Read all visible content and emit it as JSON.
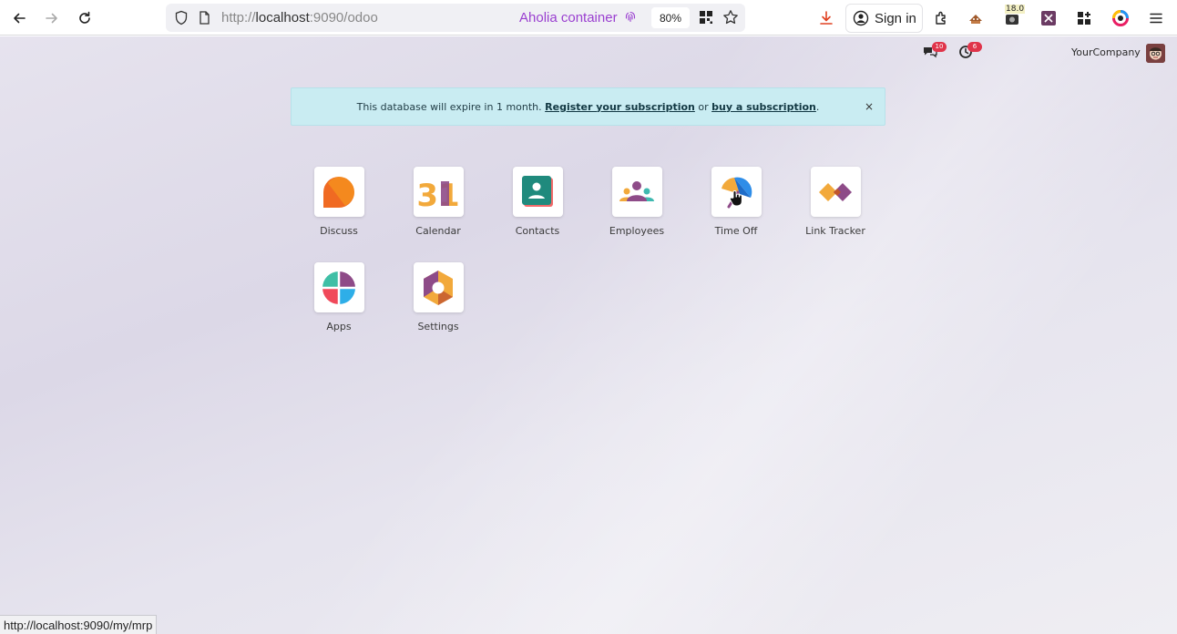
{
  "browser": {
    "url_scheme": "http://",
    "url_host": "localhost",
    "url_path": ":9090/odoo",
    "container": "Aholia container",
    "zoom": "80%",
    "signin_label": "Sign in",
    "ext_badge": "18.0"
  },
  "systray": {
    "messages_count": "10",
    "activities_count": "6",
    "company": "YourCompany"
  },
  "banner": {
    "text_before": "This database will expire in 1 month. ",
    "register_link": "Register your subscription",
    "text_middle": " or ",
    "buy_link": "buy a subscription",
    "text_after": ".",
    "close": "×"
  },
  "apps": [
    {
      "label": "Discuss",
      "icon": "discuss-icon"
    },
    {
      "label": "Calendar",
      "icon": "calendar-icon",
      "glyph": "31"
    },
    {
      "label": "Contacts",
      "icon": "contacts-icon"
    },
    {
      "label": "Employees",
      "icon": "employees-icon"
    },
    {
      "label": "Time Off",
      "icon": "time-off-icon"
    },
    {
      "label": "Link Tracker",
      "icon": "link-tracker-icon"
    },
    {
      "label": "Apps",
      "icon": "apps-icon"
    },
    {
      "label": "Settings",
      "icon": "settings-icon"
    }
  ],
  "status_url": "http://localhost:9090/my/mrp",
  "colors": {
    "banner_bg": "#c9ecf2",
    "badge": "#e0344a",
    "container_accent": "#9a3fd0"
  }
}
